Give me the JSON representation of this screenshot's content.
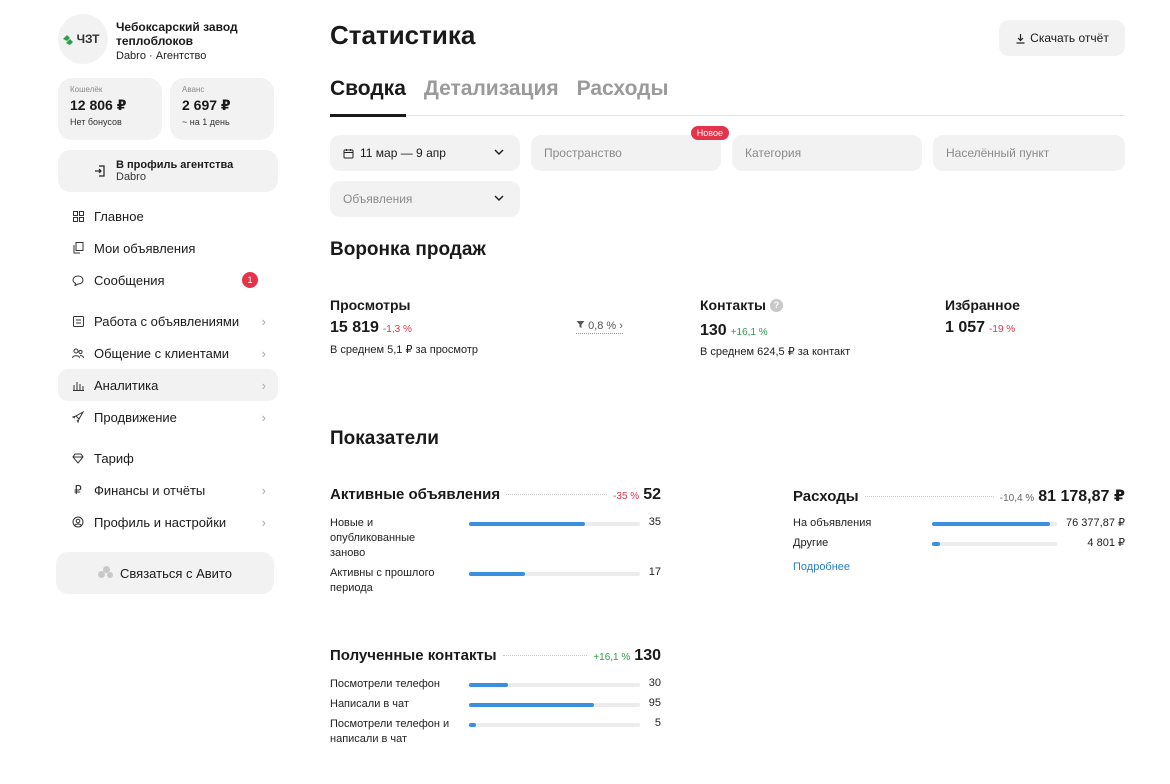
{
  "org": {
    "logo_text": "ЧЗТ",
    "name": "Чебоксарский завод теплоблоков",
    "subtitle": "Dabro · Агентство"
  },
  "wallet": {
    "label": "Кошелёк",
    "amount": "12 806 ₽",
    "note": "Нет бонусов"
  },
  "advance": {
    "label": "Аванс",
    "amount": "2 697 ₽",
    "note": "~ на 1 день"
  },
  "agency_profile": {
    "label": "В профиль агентства",
    "sub": "Dabro"
  },
  "nav": [
    {
      "label": "Главное",
      "icon": "grid-icon",
      "chevron": false,
      "badge": ""
    },
    {
      "label": "Мои объявления",
      "icon": "copy-icon",
      "chevron": false,
      "badge": ""
    },
    {
      "label": "Сообщения",
      "icon": "chat-icon",
      "chevron": false,
      "badge": "1"
    },
    {
      "label": "Работа с объявлениями",
      "icon": "list-icon",
      "chevron": true,
      "badge": ""
    },
    {
      "label": "Общение с клиентами",
      "icon": "users-icon",
      "chevron": true,
      "badge": ""
    },
    {
      "label": "Аналитика",
      "icon": "chart-icon",
      "chevron": true,
      "badge": "",
      "active": true
    },
    {
      "label": "Продвижение",
      "icon": "rocket-icon",
      "chevron": true,
      "badge": ""
    },
    {
      "label": "Тариф",
      "icon": "diamond-icon",
      "chevron": false,
      "badge": ""
    },
    {
      "label": "Финансы и отчёты",
      "icon": "ruble-icon",
      "chevron": true,
      "badge": ""
    },
    {
      "label": "Профиль и настройки",
      "icon": "user-circle-icon",
      "chevron": true,
      "badge": ""
    }
  ],
  "contact_button": "Связаться с Авито",
  "page": {
    "title": "Статистика",
    "download": "Скачать отчёт",
    "tabs": [
      "Сводка",
      "Детализация",
      "Расходы"
    ]
  },
  "filters": {
    "date": "11 мар — 9 апр",
    "space": "Пространство",
    "space_badge": "Новое",
    "category": "Категория",
    "locality": "Населённый пункт",
    "ads": "Объявления"
  },
  "funnel": {
    "title": "Воронка продаж",
    "views": {
      "label": "Просмотры",
      "value": "15 819",
      "change": "-1,3 %",
      "sub": "В среднем 5,1 ₽ за просмотр"
    },
    "conversion": "0,8 %",
    "contacts": {
      "label": "Контакты",
      "value": "130",
      "change": "+16,1 %",
      "sub": "В среднем 624,5 ₽ за контакт",
      "help": "?"
    },
    "favorites": {
      "label": "Избранное",
      "value": "1 057",
      "change": "-19 %"
    }
  },
  "indicators": {
    "title": "Показатели",
    "active_ads": {
      "title": "Активные объявления",
      "change": "-35 %",
      "total": "52",
      "rows": [
        {
          "label": "Новые и опубликованные заново",
          "value": "35",
          "share": 0.68
        },
        {
          "label": "Активны с прошлого периода",
          "value": "17",
          "share": 0.33
        }
      ]
    },
    "expenses": {
      "title": "Расходы",
      "change": "-10,4 %",
      "total": "81 178,87 ₽",
      "rows": [
        {
          "label": "На объявления",
          "value": "76 377,87 ₽",
          "share": 0.94
        },
        {
          "label": "Другие",
          "value": "4 801 ₽",
          "share": 0.06
        }
      ],
      "more": "Подробнее"
    },
    "received_contacts": {
      "title": "Полученные контакты",
      "change": "+16,1 %",
      "total": "130",
      "rows": [
        {
          "label": "Посмотрели телефон",
          "value": "30",
          "share": 0.23
        },
        {
          "label": "Написали в чат",
          "value": "95",
          "share": 0.73
        },
        {
          "label": "Посмотрели телефон и написали в чат",
          "value": "5",
          "share": 0.04
        }
      ]
    }
  },
  "colors": {
    "accent": "#3a8fdf",
    "negative": "#e3344b",
    "positive": "#2a9d4a",
    "logo_green": "#2a9d4a"
  }
}
